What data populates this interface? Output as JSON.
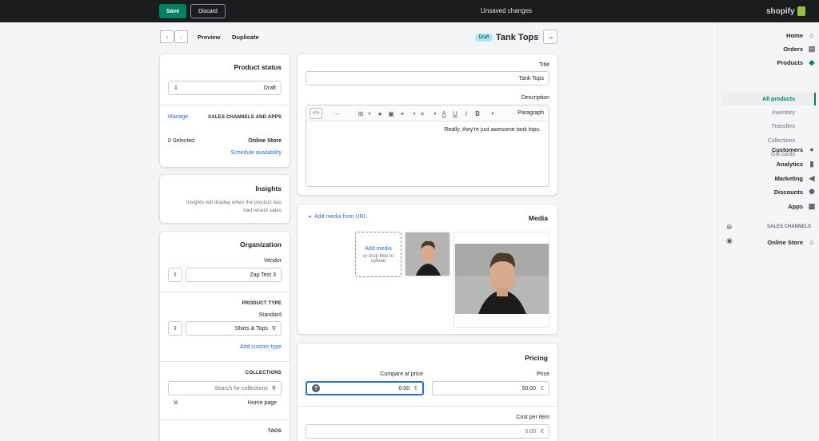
{
  "topbar": {
    "save_label": "Save",
    "discard_label": "Discard",
    "status": "Unsaved changes",
    "brand": "shopify"
  },
  "sidebar": {
    "items": [
      {
        "label": "Home",
        "icon": "home-icon"
      },
      {
        "label": "Orders",
        "icon": "orders-icon"
      },
      {
        "label": "Products",
        "icon": "tag-icon"
      },
      {
        "label": "Customers",
        "icon": "person-icon"
      },
      {
        "label": "Analytics",
        "icon": "bars-icon"
      },
      {
        "label": "Marketing",
        "icon": "megaphone-icon"
      },
      {
        "label": "Discounts",
        "icon": "discount-icon"
      },
      {
        "label": "Apps",
        "icon": "apps-icon"
      }
    ],
    "subitems": {
      "all_products": "All products",
      "inventory": "Inventory",
      "transfers": "Transfers",
      "collections": "Collections",
      "gift_cards": "Gift cards"
    },
    "sales_channels_label": "SALES CHANNELS",
    "online_store": "Online Store"
  },
  "header": {
    "title": "Tank Tops",
    "badge": "Draft",
    "duplicate": "Duplicate",
    "preview": "Preview"
  },
  "product": {
    "title_label": "Title",
    "title_value": "Tank Tops",
    "description_label": "Description",
    "format_select": "Paragraph",
    "description_text": "Really, they're just awesome tank tops."
  },
  "media": {
    "heading": "Media",
    "add_from_url": "Add media from URL",
    "add_media": "Add media",
    "drop_hint": "or drop files to upload"
  },
  "pricing": {
    "heading": "Pricing",
    "price_label": "Price",
    "price_value": "50.00",
    "compare_label": "Compare at price",
    "compare_value": "0.00",
    "cost_label": "Cost per item",
    "cost_placeholder": "0.00",
    "currency": "€"
  },
  "status_card": {
    "heading": "Product status",
    "status_value": "Draft",
    "sales_channels": "SALES CHANNELS AND APPS",
    "manage": "Manage",
    "online_store": "Online Store",
    "selected": "0 Selected",
    "schedule": "Schedule availability"
  },
  "insights": {
    "heading": "Insights",
    "text": "Insights will display when the product has had recent sales"
  },
  "organization": {
    "heading": "Organization",
    "vendor_label": "Vendor",
    "vendor_value": "Zap Test 3",
    "product_type_caption": "PRODUCT TYPE",
    "standard_label": "Standard",
    "standard_value": "Shirts & Tops",
    "add_custom_type": "Add custom type",
    "collections_caption": "COLLECTIONS",
    "collections_placeholder": "Search for collections",
    "collection_tag": "Home page",
    "tags_caption": "TAGS"
  },
  "colors": {
    "accent": "#008060",
    "link": "#2c6ecb",
    "topbar": "#1a1c1d",
    "badge": "#a4e8f2"
  }
}
